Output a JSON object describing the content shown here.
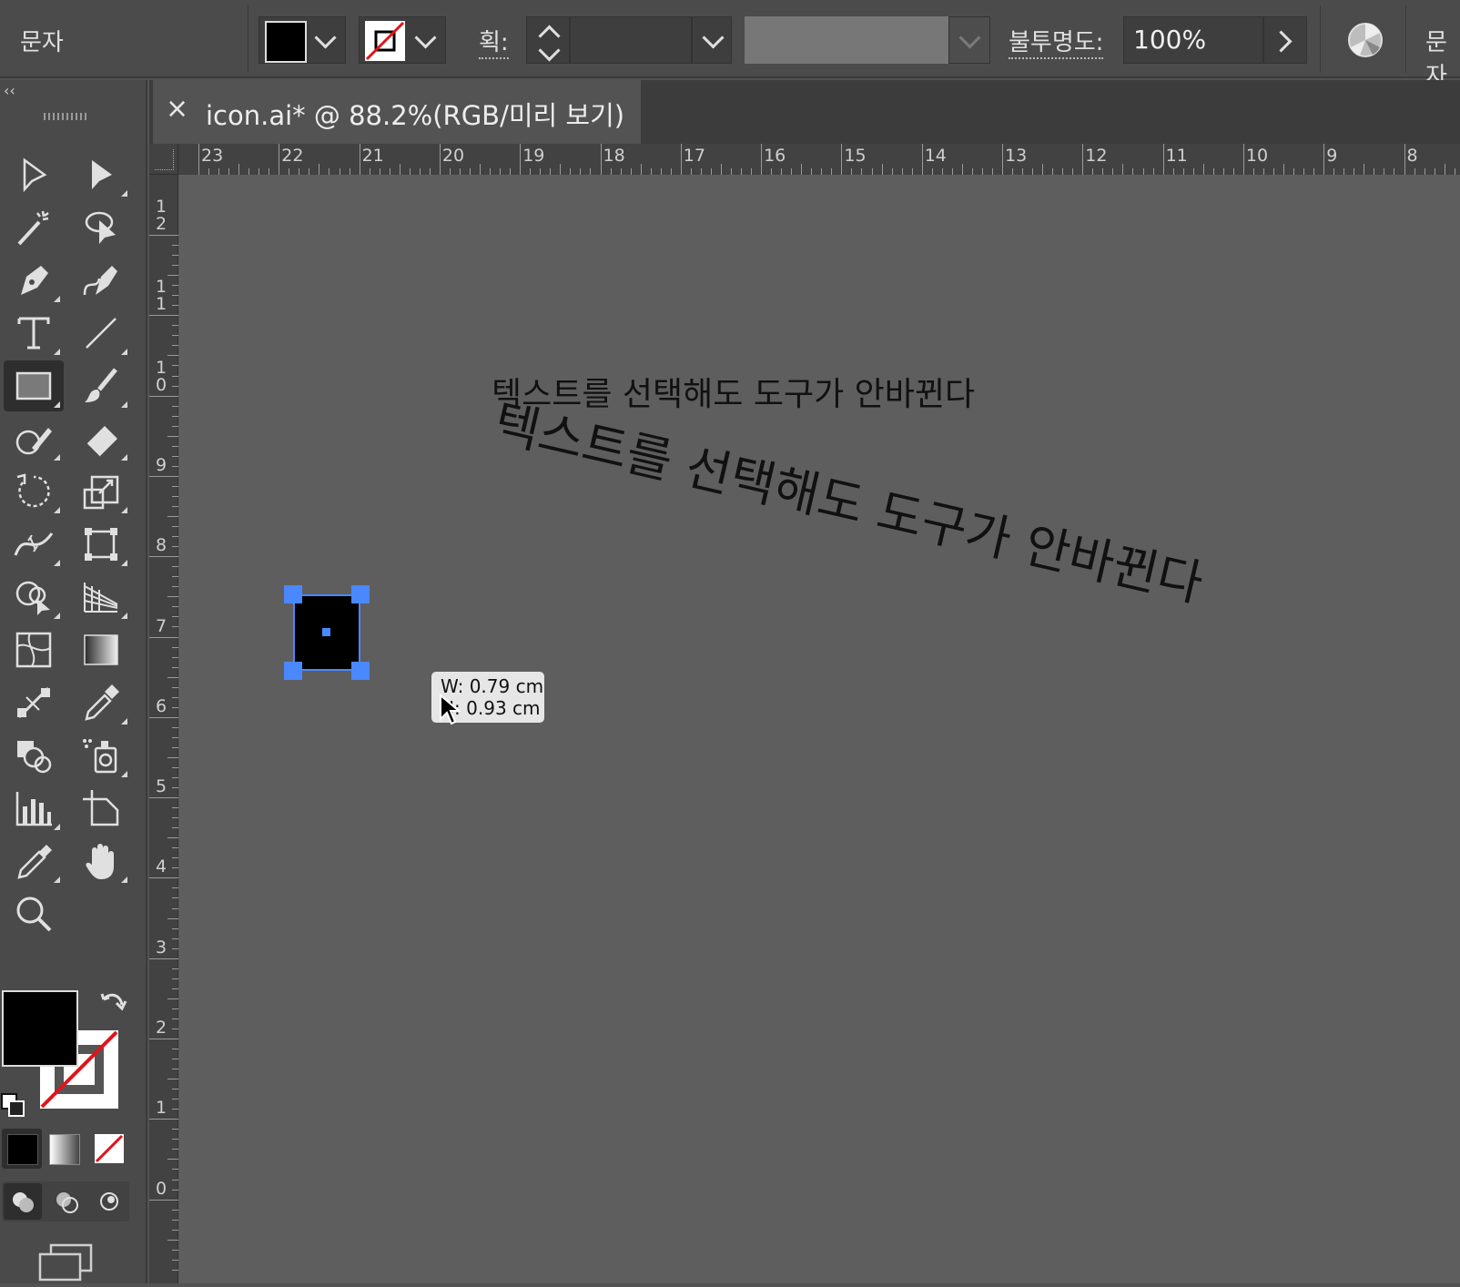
{
  "control_bar": {
    "tool_label": "문자",
    "stroke_label": "획:",
    "opacity_label": "불투명도:",
    "opacity_value": "100%",
    "right_label": "문자",
    "fill_color": "#000000",
    "stroke_color": "none"
  },
  "tab": {
    "close": "×",
    "title": "icon.ai* @ 88.2%(RGB/미리 보기)"
  },
  "ruler": {
    "horizontal": [
      "23",
      "22",
      "21",
      "20",
      "19",
      "18",
      "17",
      "16",
      "15",
      "14",
      "13",
      "12",
      "11",
      "10",
      "9",
      "8"
    ],
    "vertical": [
      "12",
      "11",
      "10",
      "9",
      "8",
      "7",
      "6",
      "5",
      "4",
      "3",
      "2",
      "1",
      "0"
    ]
  },
  "canvas": {
    "text_flat": "텍스트를 선택해도 도구가 안바뀐다",
    "text_rotated": "텍스트를 선택해도 도구가 안바뀐다",
    "tooltip_w": "W: 0.79 cm",
    "tooltip_h": "H: 0.93 cm",
    "selection_color": "#4a88ff"
  },
  "tools": [
    "selection-tool",
    "direct-selection-tool",
    "magic-wand-tool",
    "lasso-tool",
    "pen-tool",
    "curvature-tool",
    "type-tool",
    "line-segment-tool",
    "rectangle-tool",
    "paintbrush-tool",
    "shaper-tool",
    "eraser-tool",
    "rotate-tool",
    "scale-tool",
    "width-tool",
    "free-transform-tool",
    "shape-builder-tool",
    "perspective-grid-tool",
    "mesh-tool",
    "gradient-tool",
    "blend-tool",
    "eyedropper-tool",
    "symbol-sprayer-tool",
    "graph-tool",
    "artboard-tool",
    "slice-tool",
    "hand-tool",
    "zoom-tool"
  ]
}
